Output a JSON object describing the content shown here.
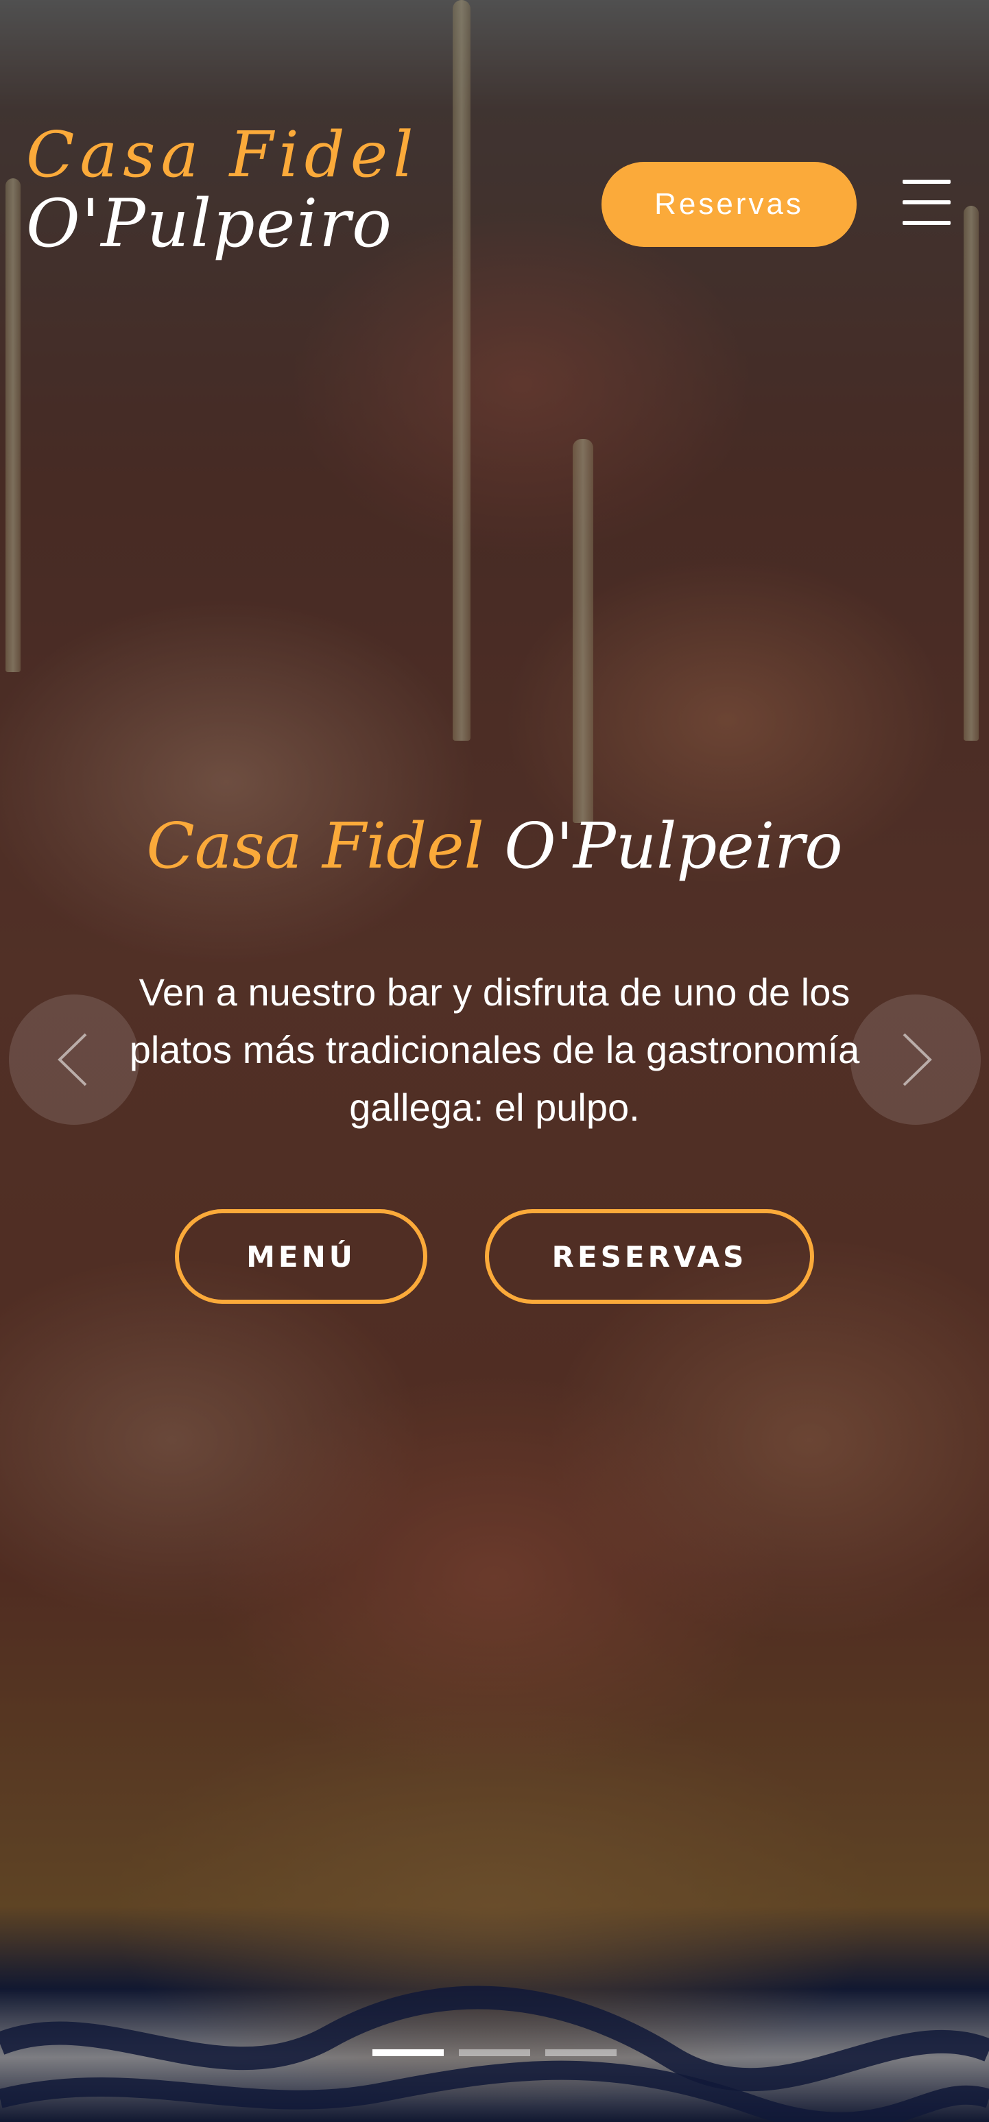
{
  "header": {
    "brand_line1": "Casa Fidel",
    "brand_line2": "O'Pulpeiro",
    "reserve_button": "Reservas",
    "menu_icon": "hamburger-menu-icon"
  },
  "hero": {
    "title_accent": "Casa Fidel",
    "title_white": "O'Pulpeiro",
    "description": "Ven a nuestro bar y disfruta de uno de los platos más tradicionales de la gastronomía gallega: el pulpo.",
    "menu_button": "MENÚ",
    "reservations_button": "RESERVAS",
    "prev_icon": "chevron-left-icon",
    "next_icon": "chevron-right-icon"
  },
  "carousel": {
    "slide_count": 3,
    "active_slide": 1
  },
  "colors": {
    "accent": "#fbaa3a",
    "text": "#ffffff"
  }
}
